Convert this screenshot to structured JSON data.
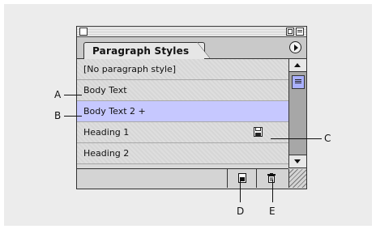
{
  "panel": {
    "tab_label": "Paragraph Styles",
    "styles": [
      {
        "label": "[No paragraph style]",
        "selected": false,
        "icon": null
      },
      {
        "label": "Body Text",
        "selected": false,
        "icon": null
      },
      {
        "label": "Body Text 2 +",
        "selected": true,
        "icon": null
      },
      {
        "label": "Heading 1",
        "selected": false,
        "icon": "disk-icon"
      },
      {
        "label": "Heading 2",
        "selected": false,
        "icon": null
      }
    ],
    "footer_icons": [
      "new-style-icon",
      "trash-icon",
      "resize-grip-icon"
    ],
    "selection_color": "#c6c8ff"
  },
  "callouts": {
    "a": "A",
    "b": "B",
    "c": "C",
    "d": "D",
    "e": "E"
  }
}
